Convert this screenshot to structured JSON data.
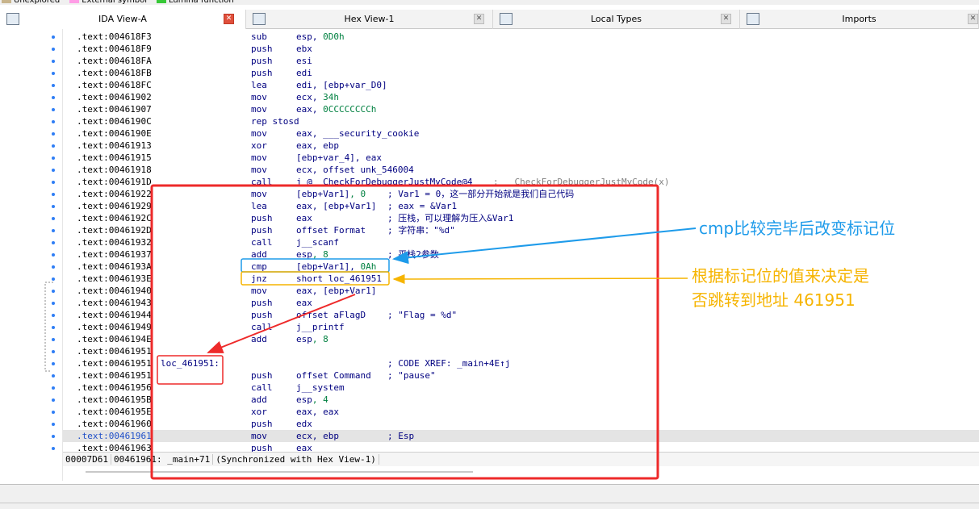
{
  "legend": [
    {
      "label": "Unexplored",
      "color": "#c8b48c"
    },
    {
      "label": "External symbol",
      "color": "#ff9de6"
    },
    {
      "label": "Lumina function",
      "color": "#37c837"
    }
  ],
  "tabs": [
    {
      "label": "IDA View-A",
      "active": true,
      "icon": "listing-icon"
    },
    {
      "label": "Hex View-1",
      "active": false,
      "icon": "hex-icon"
    },
    {
      "label": "Local Types",
      "active": false,
      "icon": "info-icon"
    },
    {
      "label": "Imports",
      "active": false,
      "icon": "imports-icon"
    }
  ],
  "rows": [
    {
      "addr": ".text:004618F3",
      "label": "",
      "mnem": "sub",
      "ops": "esp, 0D0h",
      "cmt": ""
    },
    {
      "addr": ".text:004618F9",
      "label": "",
      "mnem": "push",
      "ops": "ebx",
      "cmt": ""
    },
    {
      "addr": ".text:004618FA",
      "label": "",
      "mnem": "push",
      "ops": "esi",
      "cmt": ""
    },
    {
      "addr": ".text:004618FB",
      "label": "",
      "mnem": "push",
      "ops": "edi",
      "cmt": ""
    },
    {
      "addr": ".text:004618FC",
      "label": "",
      "mnem": "lea",
      "ops": "edi, [ebp+var_D0]",
      "cmt": ""
    },
    {
      "addr": ".text:00461902",
      "label": "",
      "mnem": "mov",
      "ops": "ecx, 34h",
      "cmt": ""
    },
    {
      "addr": ".text:00461907",
      "label": "",
      "mnem": "mov",
      "ops": "eax, 0CCCCCCCCh",
      "cmt": ""
    },
    {
      "addr": ".text:0046190C",
      "label": "",
      "mnem": "rep stosd",
      "ops": "",
      "cmt": ""
    },
    {
      "addr": ".text:0046190E",
      "label": "",
      "mnem": "mov",
      "ops": "eax, ___security_cookie",
      "cmt": ""
    },
    {
      "addr": ".text:00461913",
      "label": "",
      "mnem": "xor",
      "ops": "eax, ebp",
      "cmt": ""
    },
    {
      "addr": ".text:00461915",
      "label": "",
      "mnem": "mov",
      "ops": "[ebp+var_4], eax",
      "cmt": ""
    },
    {
      "addr": ".text:00461918",
      "label": "",
      "mnem": "mov",
      "ops": "ecx, offset unk_546004",
      "cmt": ""
    },
    {
      "addr": ".text:0046191D",
      "label": "",
      "mnem": "call",
      "ops": "j_@__CheckForDebuggerJustMyCode@4",
      "cmt": "; __CheckForDebuggerJustMyCode(x)"
    },
    {
      "addr": ".text:00461922",
      "label": "",
      "mnem": "mov",
      "ops": "[ebp+Var1], 0",
      "cmt": "; Var1 = 0，这一部分开始就是我们自己代码"
    },
    {
      "addr": ".text:00461929",
      "label": "",
      "mnem": "lea",
      "ops": "eax, [ebp+Var1]",
      "cmt": "; eax = &Var1"
    },
    {
      "addr": ".text:0046192C",
      "label": "",
      "mnem": "push",
      "ops": "eax",
      "cmt": "; 压栈，可以理解为压入&Var1"
    },
    {
      "addr": ".text:0046192D",
      "label": "",
      "mnem": "push",
      "ops": "offset Format",
      "cmt": "; 字符串：\"%d\""
    },
    {
      "addr": ".text:00461932",
      "label": "",
      "mnem": "call",
      "ops": "j__scanf",
      "cmt": ""
    },
    {
      "addr": ".text:00461937",
      "label": "",
      "mnem": "add",
      "ops": "esp, 8",
      "cmt": "; 平栈2参数"
    },
    {
      "addr": ".text:0046193A",
      "label": "",
      "mnem": "cmp",
      "ops": "[ebp+Var1], 0Ah",
      "cmt": ""
    },
    {
      "addr": ".text:0046193E",
      "label": "",
      "mnem": "jnz",
      "ops": "short loc_461951",
      "cmt": ""
    },
    {
      "addr": ".text:00461940",
      "label": "",
      "mnem": "mov",
      "ops": "eax, [ebp+Var1]",
      "cmt": ""
    },
    {
      "addr": ".text:00461943",
      "label": "",
      "mnem": "push",
      "ops": "eax",
      "cmt": ""
    },
    {
      "addr": ".text:00461944",
      "label": "",
      "mnem": "push",
      "ops": "offset aFlagD",
      "cmt": "; \"Flag = %d\""
    },
    {
      "addr": ".text:00461949",
      "label": "",
      "mnem": "call",
      "ops": "j__printf",
      "cmt": ""
    },
    {
      "addr": ".text:0046194E",
      "label": "",
      "mnem": "add",
      "ops": "esp, 8",
      "cmt": ""
    },
    {
      "addr": ".text:00461951",
      "label": "",
      "mnem": "",
      "ops": "",
      "cmt": ""
    },
    {
      "addr": ".text:00461951",
      "label": "loc_461951:",
      "mnem": "",
      "ops": "",
      "cmt": "; CODE XREF: _main+4E↑j"
    },
    {
      "addr": ".text:00461951",
      "label": "",
      "mnem": "push",
      "ops": "offset Command",
      "cmt": "; \"pause\""
    },
    {
      "addr": ".text:00461956",
      "label": "",
      "mnem": "call",
      "ops": "j__system",
      "cmt": ""
    },
    {
      "addr": ".text:0046195B",
      "label": "",
      "mnem": "add",
      "ops": "esp, 4",
      "cmt": ""
    },
    {
      "addr": ".text:0046195E",
      "label": "",
      "mnem": "xor",
      "ops": "eax, eax",
      "cmt": ""
    },
    {
      "addr": ".text:00461960",
      "label": "",
      "mnem": "push",
      "ops": "edx",
      "cmt": ""
    },
    {
      "addr": ".text:00461961",
      "label": "",
      "mnem": "mov",
      "ops": "ecx, ebp",
      "cmt": "; Esp",
      "highlight": true
    },
    {
      "addr": ".text:00461963",
      "label": "",
      "mnem": "push",
      "ops": "eax",
      "cmt": ""
    }
  ],
  "status": {
    "offset": "00007D61",
    "location": "00461961: _main+71",
    "sync": "(Synchronized with Hex View-1)"
  },
  "annotations": {
    "blue": "cmp比较完毕后改变标记位",
    "orange_line1": "根据标记位的值来决定是",
    "orange_line2": "否跳转到地址 461951"
  },
  "colors": {
    "red_box": "#ee2a2a",
    "blue_box": "#1e9bea",
    "orange_box": "#f6b400"
  }
}
